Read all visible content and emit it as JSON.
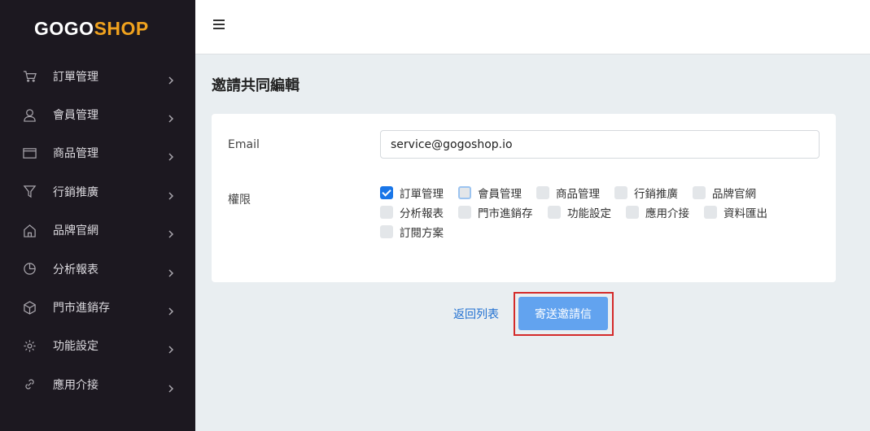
{
  "logo": {
    "part1": "GOGO",
    "part2": "SH",
    "part3": "O",
    "part4": "P",
    "brand_color": "#f0a21e"
  },
  "sidebar": {
    "items": [
      {
        "label": "訂單管理",
        "icon": "cart-icon"
      },
      {
        "label": "會員管理",
        "icon": "user-icon"
      },
      {
        "label": "商品管理",
        "icon": "browser-icon"
      },
      {
        "label": "行銷推廣",
        "icon": "filter-icon"
      },
      {
        "label": "品牌官網",
        "icon": "home-icon"
      },
      {
        "label": "分析報表",
        "icon": "pie-chart-icon"
      },
      {
        "label": "門市進銷存",
        "icon": "box-icon"
      },
      {
        "label": "功能設定",
        "icon": "gear-icon"
      },
      {
        "label": "應用介接",
        "icon": "link-icon"
      }
    ]
  },
  "header": {
    "menu_icon": "hamburger-icon"
  },
  "page": {
    "title": "邀請共同編輯"
  },
  "form": {
    "email_label": "Email",
    "email_value": "service@gogoshop.io",
    "permission_label": "權限",
    "permissions": [
      {
        "label": "訂單管理",
        "checked": true
      },
      {
        "label": "會員管理",
        "checked": false,
        "focused": true
      },
      {
        "label": "商品管理",
        "checked": false
      },
      {
        "label": "行銷推廣",
        "checked": false
      },
      {
        "label": "品牌官網",
        "checked": false
      },
      {
        "label": "分析報表",
        "checked": false
      },
      {
        "label": "門市進銷存",
        "checked": false
      },
      {
        "label": "功能設定",
        "checked": false
      },
      {
        "label": "應用介接",
        "checked": false
      },
      {
        "label": "資料匯出",
        "checked": false
      },
      {
        "label": "訂閱方案",
        "checked": false
      }
    ]
  },
  "actions": {
    "back_label": "返回列表",
    "send_label": "寄送邀請信",
    "send_color": "#62a3ef",
    "highlight_color": "#d42a2a"
  }
}
